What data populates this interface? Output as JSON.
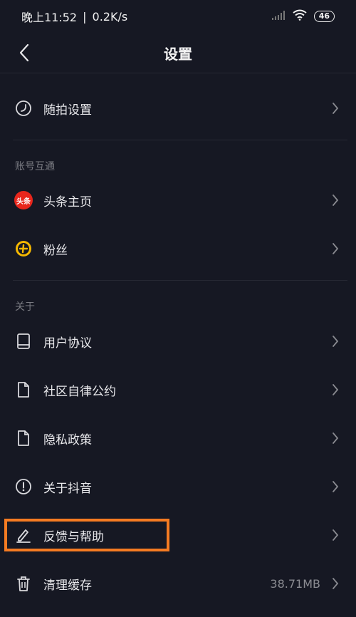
{
  "status_bar": {
    "time": "晚上11:52",
    "separator": "|",
    "speed": "0.2K/s",
    "battery": "46"
  },
  "nav": {
    "title": "设置"
  },
  "sections": {
    "account_title": "账号互通",
    "about_title": "关于"
  },
  "items": {
    "shoot_settings": "随拍设置",
    "toutiao_home": "头条主页",
    "toutiao_badge": "头条",
    "fans": "粉丝",
    "user_agreement": "用户协议",
    "community": "社区自律公约",
    "privacy": "隐私政策",
    "about": "关于抖音",
    "feedback": "反馈与帮助",
    "clear_cache": "清理缓存",
    "cache_size": "38.71MB"
  },
  "colors": {
    "background": "#161823",
    "highlight": "#f57b22",
    "toutiao_red": "#e8261c",
    "fans_yellow": "#f5b800"
  }
}
